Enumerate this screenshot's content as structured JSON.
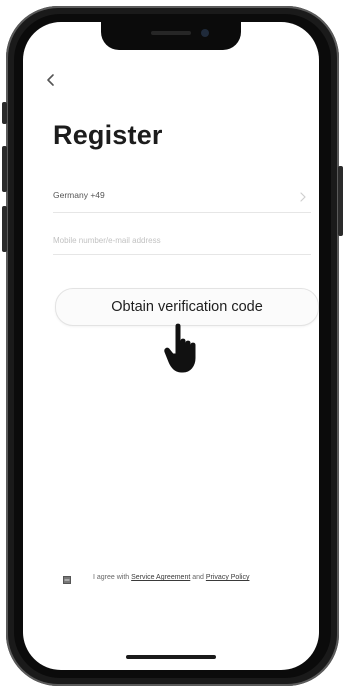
{
  "header": {
    "back_icon": "chevron-left-icon"
  },
  "page": {
    "title": "Register"
  },
  "form": {
    "country_label": "Germany +49",
    "country_chevron_icon": "chevron-right-icon",
    "account_placeholder": "Mobile number/e-mail address",
    "account_value": ""
  },
  "actions": {
    "obtain_label": "Obtain verification code",
    "pointer_icon": "hand-pointer-icon"
  },
  "agreement": {
    "checkbox_icon": "checkbox-icon",
    "text_prefix": "I agree with ",
    "service_link": "Service Agreement",
    "text_middle": " and ",
    "privacy_link": "Privacy Policy"
  },
  "colors": {
    "title": "#1c1c1c",
    "button_border": "#e3e3e3",
    "divider": "#e6e6e6",
    "phone_frame": "#1a1a1a"
  }
}
